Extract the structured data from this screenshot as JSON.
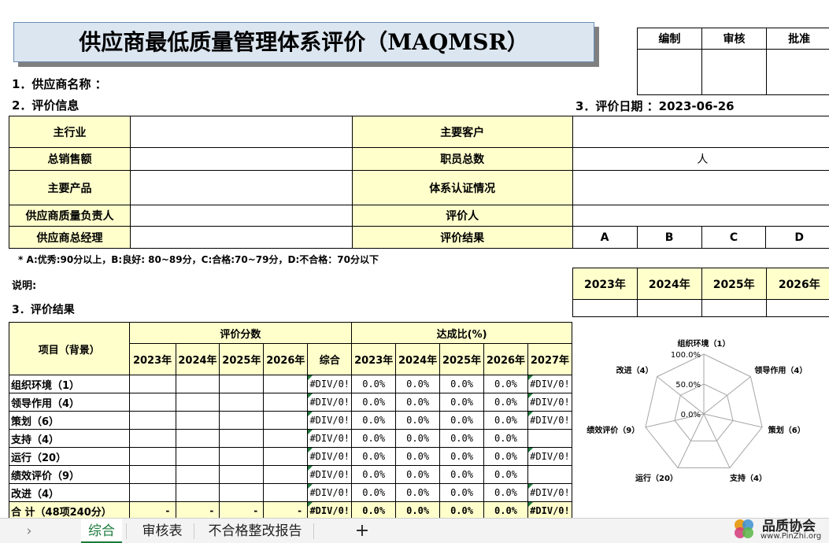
{
  "title": "供应商最低质量管理体系评价（MAQMSR）",
  "sign": {
    "headers": [
      "编制",
      "审核",
      "批准"
    ]
  },
  "sections": {
    "s1": "1．供应商名称 ：",
    "s2": "2．评价信息",
    "s3": "3．评价日期 ：2023-06-26",
    "s4": "3．评价结果"
  },
  "info": {
    "rows": [
      {
        "l1": "主行业",
        "v1": "",
        "l2": "主要客户",
        "v2": ""
      },
      {
        "l1": "总销售额",
        "v1": "",
        "l2": "职员总数",
        "v2": "人"
      },
      {
        "l1": "主要产品",
        "v1": "",
        "l2": "体系认证情况",
        "v2": ""
      },
      {
        "l1": "供应商质量负责人",
        "v1": "",
        "l2": "评价人",
        "v2": ""
      },
      {
        "l1": "供应商总经理",
        "v1": "",
        "l2": "评价结果",
        "v2": ""
      }
    ],
    "grades": [
      "A",
      "B",
      "C",
      "D"
    ]
  },
  "legend_note": "* A:优秀:90分以上，B:良好: 80~89分，C:合格:70~79分，D:不合格：70分以下",
  "note_label": "说明:",
  "years_box": [
    "2023年",
    "2024年",
    "2025年",
    "2026年"
  ],
  "results": {
    "col_item": "项目（背景）",
    "col_score": "评价分数",
    "col_rate": "达成比(%)",
    "score_years": [
      "2023年",
      "2024年",
      "2025年",
      "2026年",
      "综合"
    ],
    "rate_years": [
      "2023年",
      "2024年",
      "2025年",
      "2026年",
      "2027年"
    ],
    "rows": [
      {
        "name": "组织环境（1）",
        "scores": [
          "",
          "",
          "",
          "",
          "#DIV/0!"
        ],
        "rates": [
          "0.0%",
          "0.0%",
          "0.0%",
          "0.0%",
          "#DIV/0!"
        ]
      },
      {
        "name": "领导作用（4）",
        "scores": [
          "",
          "",
          "",
          "",
          "#DIV/0!"
        ],
        "rates": [
          "0.0%",
          "0.0%",
          "0.0%",
          "0.0%",
          "#DIV/0!"
        ]
      },
      {
        "name": "策划（6）",
        "scores": [
          "",
          "",
          "",
          "",
          "#DIV/0!"
        ],
        "rates": [
          "0.0%",
          "0.0%",
          "0.0%",
          "0.0%",
          "#DIV/0!"
        ]
      },
      {
        "name": "支持（4）",
        "scores": [
          "",
          "",
          "",
          "",
          "#DIV/0!"
        ],
        "rates": [
          "0.0%",
          "0.0%",
          "0.0%",
          "0.0%",
          ""
        ]
      },
      {
        "name": "运行（20）",
        "scores": [
          "",
          "",
          "",
          "",
          "#DIV/0!"
        ],
        "rates": [
          "0.0%",
          "0.0%",
          "0.0%",
          "0.0%",
          "#DIV/0!"
        ]
      },
      {
        "name": "绩效评价（9）",
        "scores": [
          "",
          "",
          "",
          "",
          "#DIV/0!"
        ],
        "rates": [
          "0.0%",
          "0.0%",
          "0.0%",
          "0.0%",
          ""
        ]
      },
      {
        "name": "改进（4）",
        "scores": [
          "",
          "",
          "",
          "",
          "#DIV/0!"
        ],
        "rates": [
          "0.0%",
          "0.0%",
          "0.0%",
          "0.0%",
          "#DIV/0!"
        ]
      }
    ],
    "total": {
      "name": "合 计（48项240分）",
      "scores": [
        "-",
        "-",
        "-",
        "-",
        "#DIV/0!"
      ],
      "rates": [
        "0.0%",
        "0.0%",
        "0.0%",
        "0.0%",
        "#DIV/0!"
      ]
    }
  },
  "chart_data": {
    "type": "radar",
    "categories": [
      "组织环境（1）",
      "领导作用（4）",
      "策划（6）",
      "支持（4）",
      "运行（20）",
      "绩效评价（9）",
      "改进（4）"
    ],
    "tick_labels": [
      "100.0%",
      "50.0%",
      "0.0%"
    ],
    "rlim": [
      0,
      100
    ],
    "series": [
      {
        "values": [
          0,
          0,
          0,
          0,
          0,
          0,
          0
        ]
      }
    ]
  },
  "tabs": [
    "综合",
    "审核表",
    "不合格整改报告"
  ],
  "add_tab": "+",
  "watermark": {
    "name": "品质协会",
    "url": "www.PinZhi.org"
  }
}
